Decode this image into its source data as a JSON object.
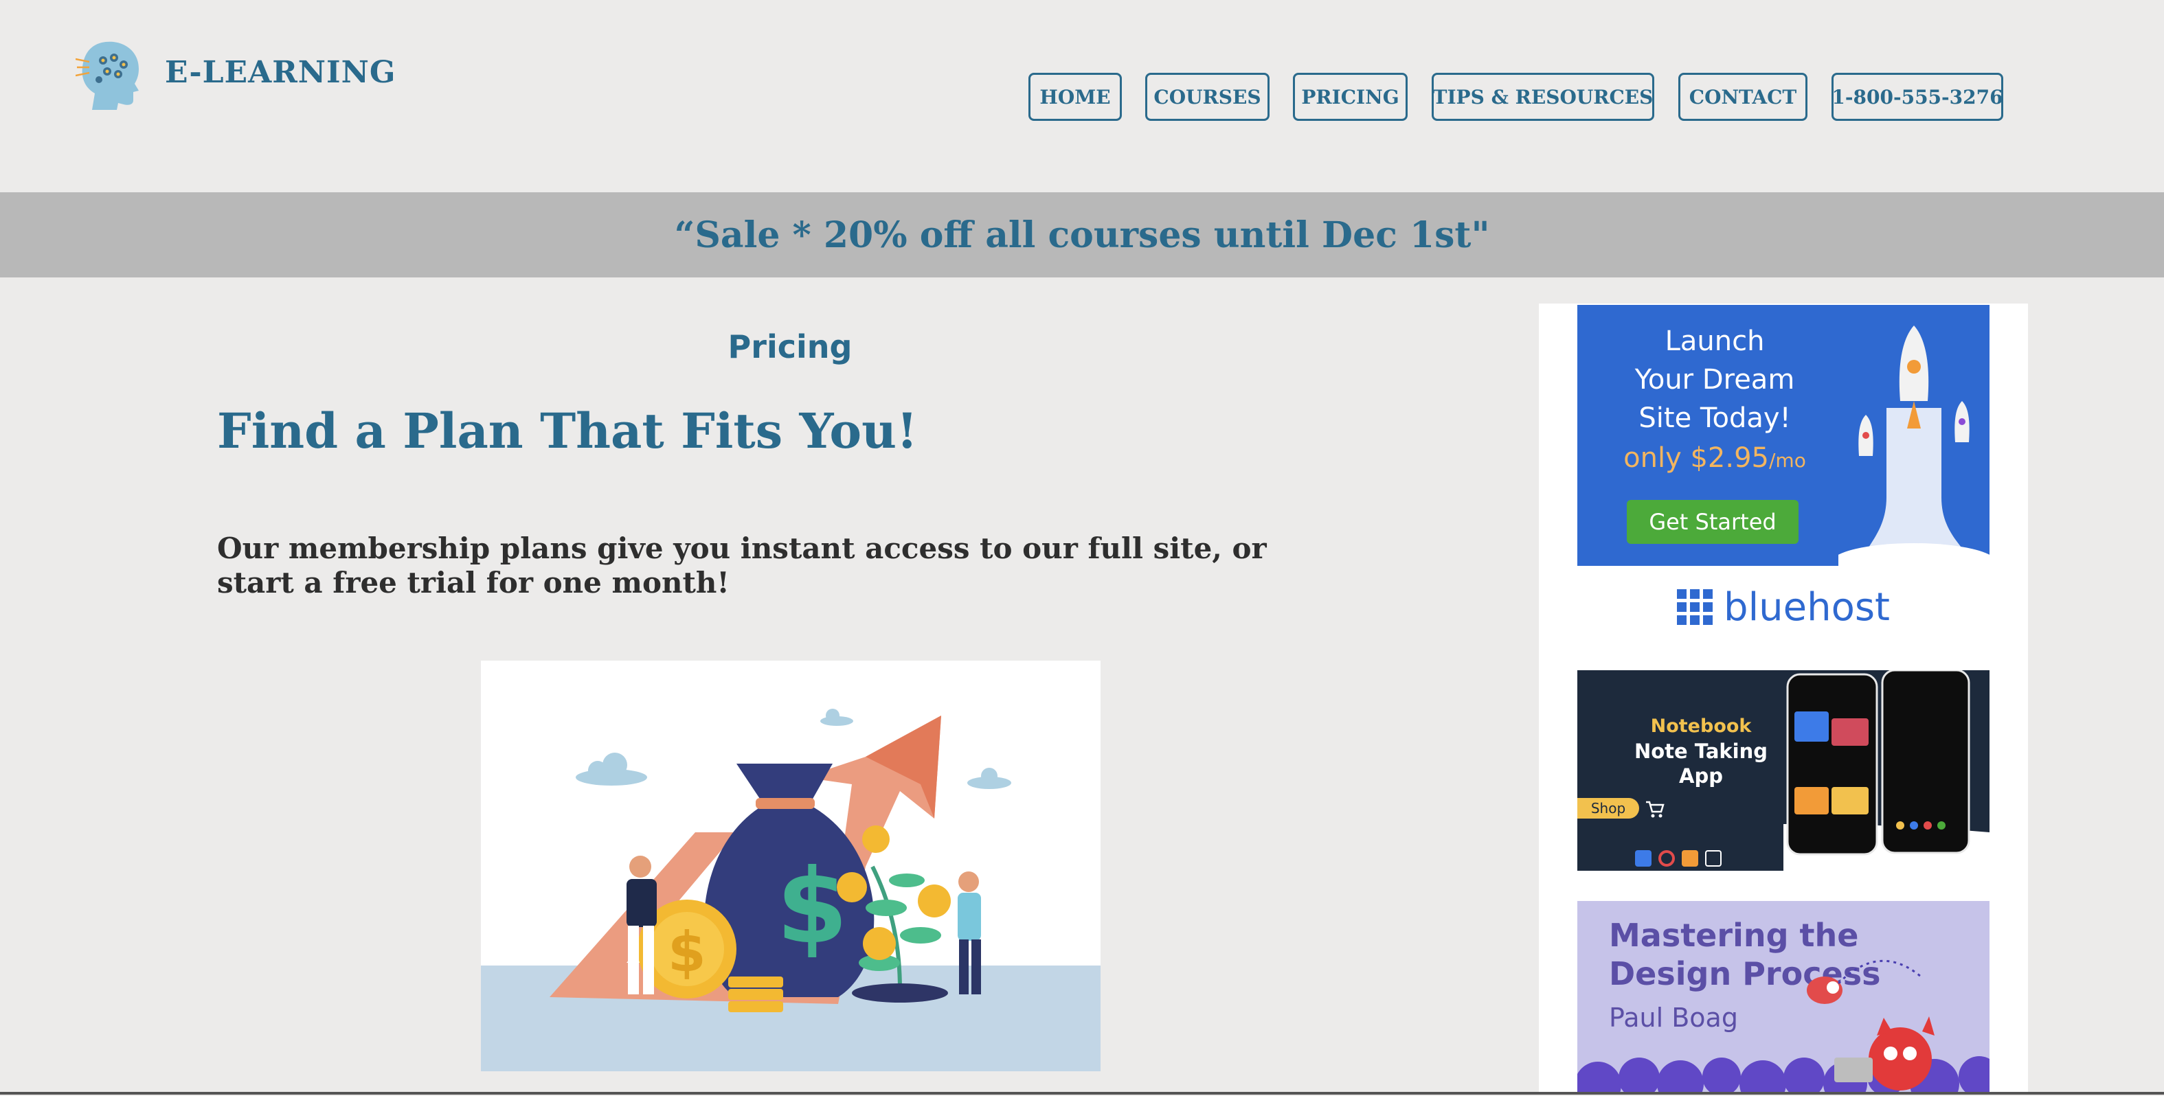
{
  "brand": {
    "name": "E-LEARNING",
    "logo_icon": "head-brain-icon"
  },
  "nav": {
    "items": [
      {
        "label": "HOME"
      },
      {
        "label": "COURSES"
      },
      {
        "label": "PRICING"
      },
      {
        "label": "TIPS & RESOURCES"
      },
      {
        "label": "CONTACT"
      },
      {
        "label": "1-800-555-3276"
      }
    ]
  },
  "banner": {
    "text": "“Sale * 20% off all courses until Dec 1st\""
  },
  "main": {
    "section_label": "Pricing",
    "title": "Find a Plan That Fits You!",
    "intro": "Our membership plans give you instant access to our full site, or start a free trial for one month!",
    "hero_image": "money-bag-growth-illustration"
  },
  "sidebar": {
    "ads": [
      {
        "headline_lines": [
          "Launch",
          "Your Dream",
          "Site Today!"
        ],
        "price": "only $2.95",
        "price_suffix": "/mo",
        "cta": "Get Started",
        "brand": "bluehost",
        "colors": {
          "background": "#2f69d0",
          "cta": "#4caa3a",
          "price": "#f3b55f"
        }
      },
      {
        "eyebrow": "Notebook",
        "headline": "Note Taking App",
        "cta": "Shop",
        "colors": {
          "background": "#1d2a3c",
          "accent": "#f2c14e"
        }
      },
      {
        "headline": "Mastering the Design Process",
        "author": "Paul Boag",
        "colors": {
          "background": "#c6c3e9",
          "text": "#5b4fa6"
        }
      }
    ]
  },
  "colors": {
    "accent": "#2a6a8c",
    "page_bg": "#ecebea",
    "banner_bg": "#b8b8b8"
  }
}
